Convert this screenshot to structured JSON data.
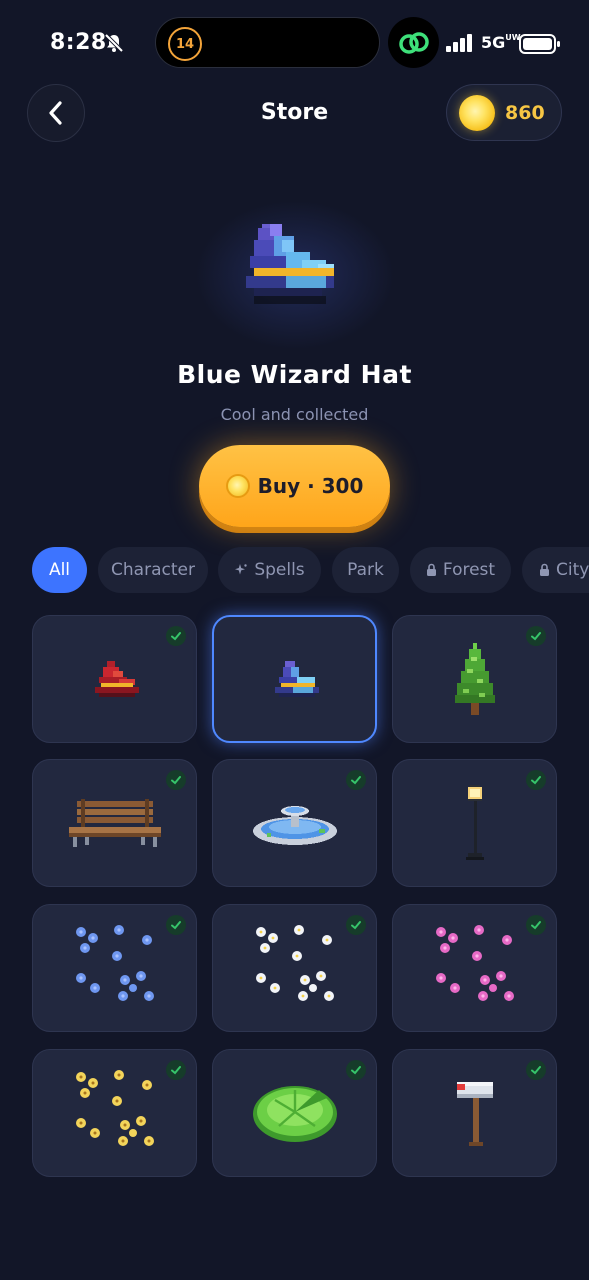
{
  "status": {
    "time": "8:28",
    "island_badge": "14",
    "network": "5G",
    "network_suffix": "UW"
  },
  "header": {
    "title": "Store",
    "coins": "860"
  },
  "hero": {
    "item_name": "Blue Wizard Hat",
    "item_desc": "Cool and collected",
    "buy_label": "Buy · 300"
  },
  "categories": [
    {
      "label": "All",
      "active": true,
      "icon": ""
    },
    {
      "label": "Character",
      "active": false,
      "icon": ""
    },
    {
      "label": "Spells",
      "active": false,
      "icon": "sparkle-icon"
    },
    {
      "label": "Park",
      "active": false,
      "icon": ""
    },
    {
      "label": "Forest",
      "active": false,
      "icon": "lock-icon"
    },
    {
      "label": "City",
      "active": false,
      "icon": "lock-icon"
    }
  ],
  "items": [
    {
      "name": "red-wizard-hat",
      "owned": true,
      "selected": false
    },
    {
      "name": "blue-wizard-hat",
      "owned": false,
      "selected": true
    },
    {
      "name": "pine-tree",
      "owned": true,
      "selected": false
    },
    {
      "name": "park-bench",
      "owned": true,
      "selected": false
    },
    {
      "name": "fountain",
      "owned": true,
      "selected": false
    },
    {
      "name": "street-lamp",
      "owned": true,
      "selected": false
    },
    {
      "name": "blue-flowers",
      "owned": true,
      "selected": false
    },
    {
      "name": "white-flowers",
      "owned": true,
      "selected": false
    },
    {
      "name": "pink-flowers",
      "owned": true,
      "selected": false
    },
    {
      "name": "yellow-flowers",
      "owned": true,
      "selected": false
    },
    {
      "name": "lily-pad",
      "owned": true,
      "selected": false
    },
    {
      "name": "mailbox",
      "owned": true,
      "selected": false
    }
  ],
  "colors": {
    "background": "#121628",
    "accent": "#3d74ff",
    "coin": "#f7c644",
    "buy": "#ffb02e",
    "card": "#22283f",
    "owned_check": "#36c46a"
  }
}
